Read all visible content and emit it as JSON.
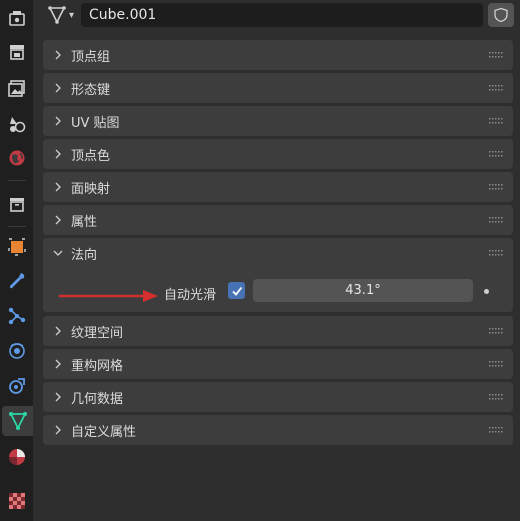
{
  "object": {
    "name": "Cube.001"
  },
  "panels": [
    {
      "label": "顶点组"
    },
    {
      "label": "形态键"
    },
    {
      "label": "UV 贴图"
    },
    {
      "label": "顶点色"
    },
    {
      "label": "面映射"
    },
    {
      "label": "属性"
    },
    {
      "label": "法向"
    },
    {
      "label": "纹理空间"
    },
    {
      "label": "重构网格"
    },
    {
      "label": "几何数据"
    },
    {
      "label": "自定义属性"
    }
  ],
  "normals": {
    "auto_smooth_label": "自动光滑",
    "auto_smooth_enabled": true,
    "angle_value": "43.1°"
  },
  "colors": {
    "accent": "#4772b3",
    "annotation_arrow": "#d32f2f",
    "active_tab_icon": "#29d6a4"
  },
  "sidebar_tabs": [
    "tool-icon",
    "render-icon",
    "output-icon",
    "view-layer-icon",
    "scene-icon",
    "world-icon",
    "collection-icon",
    "object-icon",
    "modifier-icon",
    "particles-icon",
    "physics-icon",
    "constraints-icon",
    "mesh-data-icon",
    "material-icon",
    "texture-icon"
  ]
}
